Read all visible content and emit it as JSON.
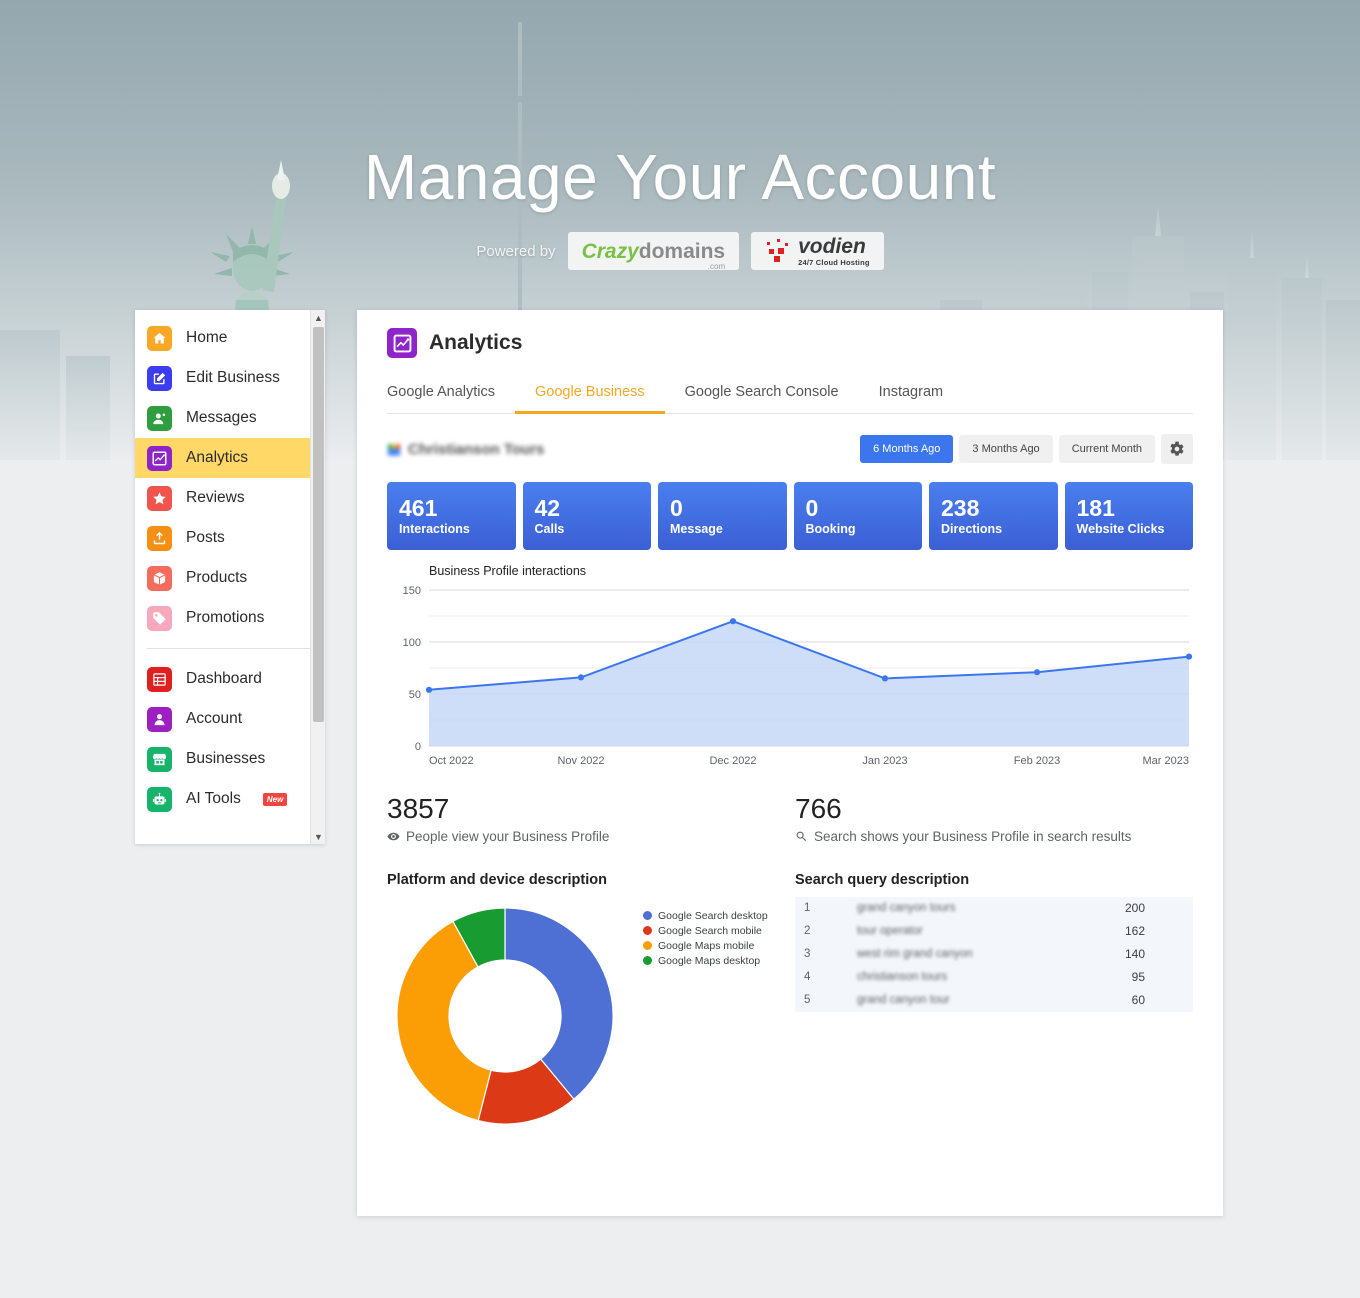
{
  "hero": {
    "title": "Manage Your Account",
    "powered_by": "Powered by",
    "logo_crazy": "Crazy",
    "logo_domains": "domains",
    "logo_com": ".com",
    "logo_vodien": "vodien",
    "logo_vodien_sub": "24/7 Cloud Hosting"
  },
  "sidebar": {
    "group1": [
      {
        "label": "Home",
        "icon": "home-icon",
        "color": "#f9a825",
        "active": false
      },
      {
        "label": "Edit Business",
        "icon": "edit-icon",
        "color": "#3d3df0",
        "active": false
      },
      {
        "label": "Messages",
        "icon": "messages-icon",
        "color": "#2e9e3e",
        "active": false
      },
      {
        "label": "Analytics",
        "icon": "analytics-icon",
        "color": "#8e24c9",
        "active": true
      },
      {
        "label": "Reviews",
        "icon": "star-icon",
        "color": "#f0544c",
        "active": false
      },
      {
        "label": "Posts",
        "icon": "upload-icon",
        "color": "#f59015",
        "active": false
      },
      {
        "label": "Products",
        "icon": "box-icon",
        "color": "#f56b5c",
        "active": false
      },
      {
        "label": "Promotions",
        "icon": "tag-icon",
        "color": "#f7a8bc",
        "active": false
      }
    ],
    "group2": [
      {
        "label": "Dashboard",
        "icon": "grid-icon",
        "color": "#e02020",
        "active": false
      },
      {
        "label": "Account",
        "icon": "person-icon",
        "color": "#9b1fc1",
        "active": false
      },
      {
        "label": "Businesses",
        "icon": "store-icon",
        "color": "#18b36b",
        "active": false
      },
      {
        "label": "AI Tools",
        "icon": "robot-icon",
        "color": "#18b36b",
        "active": false,
        "badge": "New"
      }
    ]
  },
  "card": {
    "title": "Analytics",
    "title_icon": "analytics-icon",
    "tabs": [
      {
        "label": "Google Analytics",
        "active": false
      },
      {
        "label": "Google Business",
        "active": true
      },
      {
        "label": "Google Search Console",
        "active": false
      },
      {
        "label": "Instagram",
        "active": false
      }
    ],
    "business_name": "Christianson Tours",
    "range_buttons": [
      {
        "label": "6 Months Ago",
        "active": true
      },
      {
        "label": "3 Months Ago",
        "active": false
      },
      {
        "label": "Current Month",
        "active": false
      }
    ],
    "settings_icon": "gear-icon",
    "stats": [
      {
        "value": "461",
        "label": "Interactions"
      },
      {
        "value": "42",
        "label": "Calls"
      },
      {
        "value": "0",
        "label": "Message"
      },
      {
        "value": "0",
        "label": "Booking"
      },
      {
        "value": "238",
        "label": "Directions"
      },
      {
        "value": "181",
        "label": "Website Clicks"
      }
    ],
    "views": {
      "value": "3857",
      "caption": "People view your Business Profile",
      "icon": "eye-icon",
      "section_title": "Platform and device description"
    },
    "searches": {
      "value": "766",
      "caption": "Search shows your Business Profile in search results",
      "icon": "search-icon",
      "section_title": "Search query description"
    },
    "search_queries": [
      {
        "rank": "1",
        "term": "grand canyon tours",
        "count": "200"
      },
      {
        "rank": "2",
        "term": "tour operator",
        "count": "162"
      },
      {
        "rank": "3",
        "term": "west rim grand canyon",
        "count": "140"
      },
      {
        "rank": "4",
        "term": "christianson tours",
        "count": "95"
      },
      {
        "rank": "5",
        "term": "grand canyon tour",
        "count": "60"
      }
    ]
  },
  "chart_data": [
    {
      "type": "area",
      "title": "Business Profile interactions",
      "categories": [
        "Oct 2022",
        "Nov 2022",
        "Dec 2022",
        "Jan 2023",
        "Feb 2023",
        "Mar 2023"
      ],
      "values": [
        54,
        66,
        120,
        65,
        71,
        86
      ],
      "ylim": [
        0,
        150
      ],
      "yticks": [
        0,
        50,
        100,
        150
      ],
      "gridlines": [
        0,
        25,
        50,
        75,
        100,
        125,
        150
      ],
      "xlabel": "",
      "ylabel": "",
      "grid": true,
      "line_color": "#3b76ef",
      "fill_color": "#c6d8f7"
    },
    {
      "type": "pie",
      "title": "Platform and device description",
      "labels": [
        "Google Search desktop",
        "Google Search mobile",
        "Google Maps mobile",
        "Google Maps desktop"
      ],
      "values": [
        39,
        15,
        38,
        8
      ],
      "colors": [
        "#4e6fd4",
        "#dc3a16",
        "#fb9e05",
        "#189b31"
      ],
      "legend_position": "right",
      "donut": true
    }
  ]
}
